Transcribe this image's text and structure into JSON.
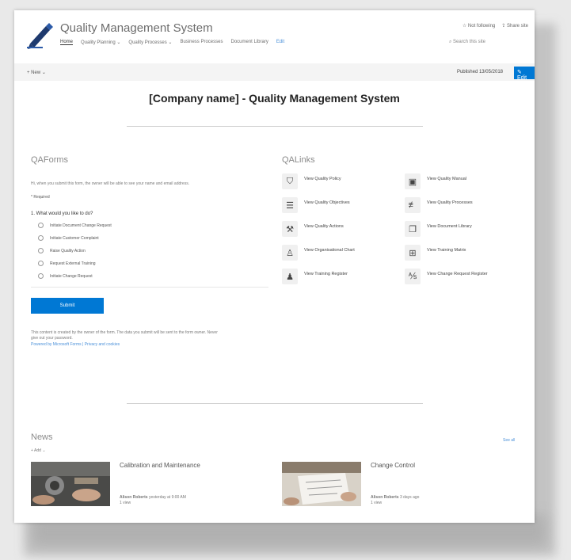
{
  "header": {
    "site_title": "Quality Management System",
    "nav": [
      "Home",
      "Quality Planning ⌄",
      "Quality Processes ⌄",
      "Business Processes",
      "Document Library",
      "Edit"
    ],
    "not_following": "☆ Not following",
    "share_site": "⇪ Share site",
    "search_placeholder": "⌕ Search this site"
  },
  "cmdbar": {
    "new": "+ New ⌄",
    "published": "Published 13/05/2018",
    "edit": "✎ Edit"
  },
  "page_title": "[Company name] - Quality Management System",
  "forms": {
    "title": "QAForms",
    "intro": "Hi, when you submit this form, the owner will be able to see your name and email address.",
    "required": "* Required",
    "question": "1. What would you like to do?",
    "options": [
      "Initiate Document Change Request",
      "Initiate Customer Complaint",
      "Raise Quality Action",
      "Request External Training",
      "Initiate Change Request"
    ],
    "submit": "Submit",
    "footer1": "This content is created by the owner of the form. The data you submit will be sent to the form owner. Never",
    "footer2": "give out your password.",
    "footer3": "Powered by Microsoft Forms | Privacy and cookies"
  },
  "links": {
    "title": "QALinks",
    "left": [
      {
        "icon": "shield",
        "label": "View Quality Policy"
      },
      {
        "icon": "list",
        "label": "View Quality Objectives"
      },
      {
        "icon": "wrench",
        "label": "View Quality Actions"
      },
      {
        "icon": "org",
        "label": "View Organisational Chart"
      },
      {
        "icon": "people",
        "label": "View Training Register"
      }
    ],
    "right": [
      {
        "icon": "book",
        "label": "View Quality Manual"
      },
      {
        "icon": "sliders",
        "label": "View Quality Processes"
      },
      {
        "icon": "docs",
        "label": "View Document Library"
      },
      {
        "icon": "matrix",
        "label": "View Training Matrix"
      },
      {
        "icon": "register",
        "label": "View Change Request Register"
      }
    ]
  },
  "news": {
    "title": "News",
    "add": "+ Add ⌄",
    "see_all": "See all",
    "items": [
      {
        "title": "Calibration and Maintenance",
        "author": "Alison Roberts",
        "date": "yesterday at 9:00 AM",
        "views": "1 view"
      },
      {
        "title": "Change Control",
        "author": "Alison Roberts",
        "date": "3 days ago",
        "views": "1 view"
      }
    ]
  }
}
